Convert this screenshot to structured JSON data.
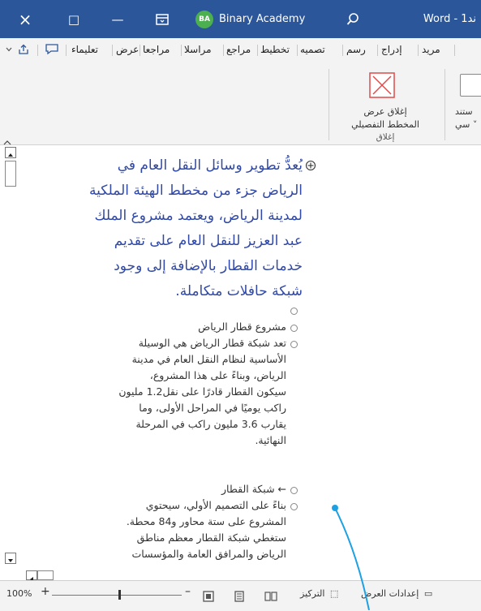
{
  "titlebar": {
    "close_glyph": "×",
    "restore_glyph": "□",
    "minimize_glyph": "—",
    "user_initials": "BA",
    "account_name": "Binary Academy",
    "app_title": "Word - 1ند"
  },
  "ribbon_tabs": [
    "تعليماء",
    "عرض",
    "مراجعا",
    "مراسلا",
    "مراجع",
    "تخطيط",
    "تصميه",
    "رسم",
    "إدراج",
    "مريد"
  ],
  "ribbon": {
    "close_view_line1": "إغلاق عرض",
    "close_view_line2": "المخطط التفصيلي",
    "group_close": "إغلاق",
    "doc_line1": "ستند",
    "doc_line2": "سي ˅"
  },
  "document": {
    "heading_lines": [
      "يُعدُّ تطوير وسائل النقل العام في",
      "الرياض جزء من مخطط الهيئة الملكية",
      "لمدينة الرياض، ويعتمد مشروع الملك",
      "عبد العزيز للنقل العام على تقديم",
      "خدمات القطار بالإضافة إلى وجود",
      "شبكة حافلات متكاملة."
    ],
    "item1": "مشروع قطار الرياض",
    "item2_lines": [
      "تعد شبكة قطار الرياض هي الوسيلة",
      "الأساسية لنظام النقل العام في مدينة",
      "الرياض، وبناءً على هذا المشروع،",
      "سيكون القطار قادرًا على نقل1.2 مليون",
      "راكب يوميًا في المراحل الأولى، وما",
      "يقارب 3.6 مليون راكب في المرحلة",
      "النهائية."
    ],
    "item3": "← شبكة القطار",
    "item4_lines": [
      "بناءً على التصميم الأولي، سيحتوي",
      "المشروع على ستة محاور و84 محطة.",
      "ستغطي شبكة القطار معظم مناطق",
      "الرياض والمرافق العامة والمؤسسات"
    ]
  },
  "statusbar": {
    "zoom": "100%",
    "focus_label": "التركيز",
    "display_settings_label": "إعدادات العرض"
  },
  "colors": {
    "titlebar": "#2b579a",
    "heading_text": "#3149a6",
    "annotation_line": "#1da1e2",
    "close_icon": "#e04b4b"
  }
}
